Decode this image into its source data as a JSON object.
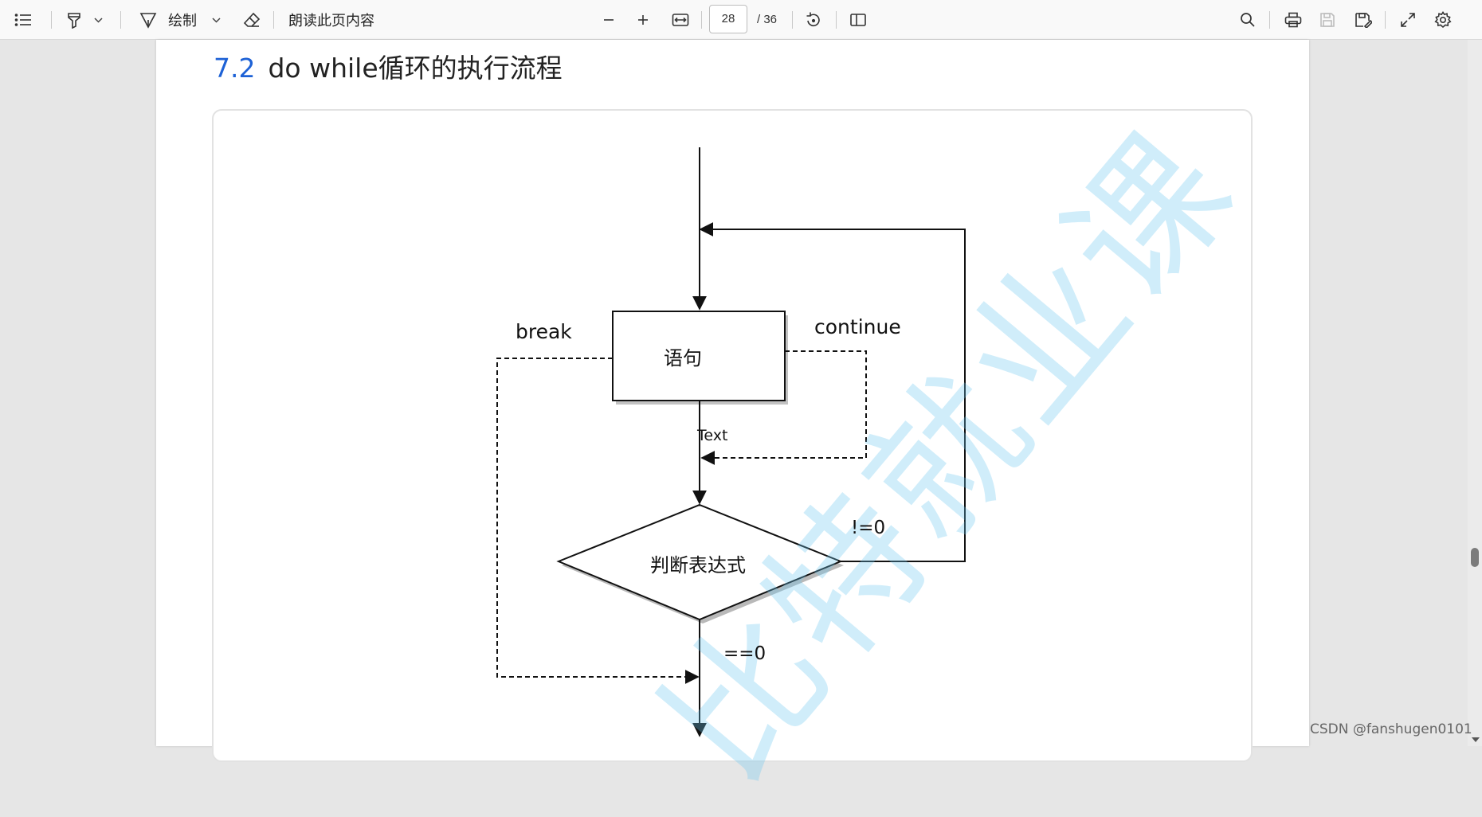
{
  "toolbar": {
    "draw_label": "绘制",
    "read_aloud_label": "朗读此页内容",
    "current_page": "28",
    "total_pages": "/ 36"
  },
  "document": {
    "section_number": "7.2",
    "section_title": "do while循环的执行流程",
    "watermark": "比特就业课"
  },
  "flowchart": {
    "statement": "语句",
    "condition": "判断表达式",
    "break_label": "break",
    "continue_label": "continue",
    "text_label": "Text",
    "true_label": "!=0",
    "false_label": "==0"
  },
  "footer": {
    "credit": "CSDN @fanshugen0101"
  }
}
